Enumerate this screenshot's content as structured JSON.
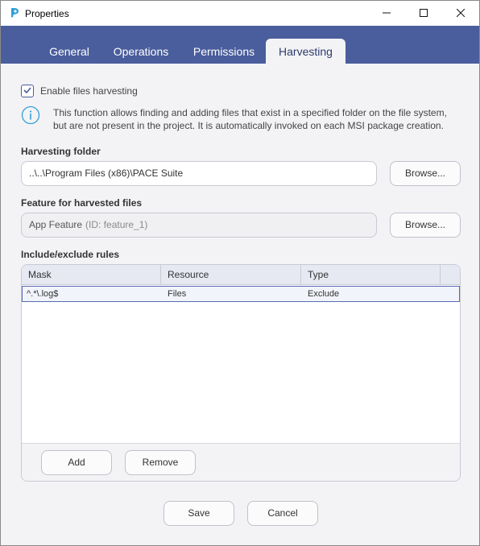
{
  "window": {
    "title": "Properties",
    "app_icon": "pace-suite-logo-icon"
  },
  "tabs": [
    {
      "label": "General",
      "active": false
    },
    {
      "label": "Operations",
      "active": false
    },
    {
      "label": "Permissions",
      "active": false
    },
    {
      "label": "Harvesting",
      "active": true
    }
  ],
  "harvesting": {
    "enable_label": "Enable files harvesting",
    "enable_checked": true,
    "info_text": "This function allows finding and adding files that exist in a specified folder on the file system, but are not present in the project. It is automatically invoked on each MSI package creation.",
    "folder_label": "Harvesting folder",
    "folder_value": "..\\..\\Program Files (x86)\\PACE Suite",
    "folder_browse": "Browse...",
    "feature_label": "Feature for harvested files",
    "feature_value": "App Feature",
    "feature_id": "(ID: feature_1)",
    "feature_browse": "Browse...",
    "rules_label": "Include/exclude rules",
    "rules_columns": [
      "Mask",
      "Resource",
      "Type"
    ],
    "rules_rows": [
      {
        "mask": "^.*\\.log$",
        "resource": "Files",
        "type": "Exclude"
      }
    ],
    "add_label": "Add",
    "remove_label": "Remove"
  },
  "footer": {
    "save_label": "Save",
    "cancel_label": "Cancel"
  },
  "colors": {
    "tabbar": "#4a5d9c",
    "accent": "#2f9fd6",
    "selection_border": "#5a6ab0"
  }
}
